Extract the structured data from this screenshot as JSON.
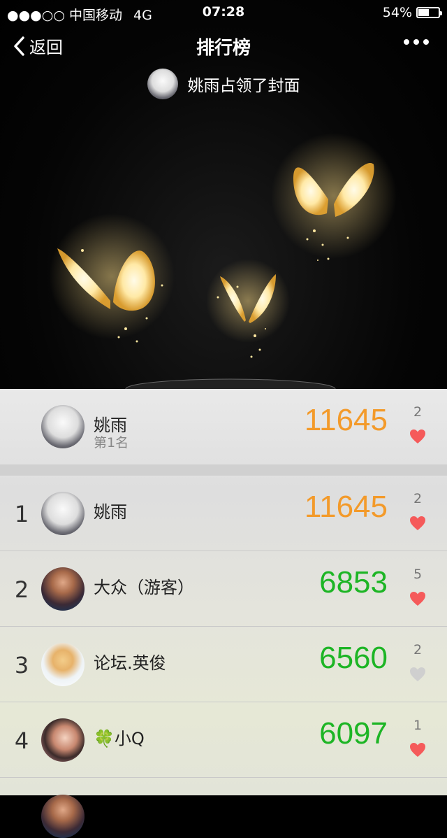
{
  "status_bar": {
    "signal": "●●●○○",
    "carrier": "中国移动",
    "network": "4G",
    "time": "07:28",
    "battery": "54%",
    "battery_level": 0.54
  },
  "nav": {
    "back_label": "返回",
    "title": "排行榜"
  },
  "cover": {
    "text": "姚雨占领了封面"
  },
  "my_rank": {
    "name": "姚雨",
    "position": "第1名",
    "steps": "11645",
    "likes": "2",
    "liked": true
  },
  "ranking": [
    {
      "rank": "1",
      "name": "姚雨",
      "steps": "11645",
      "likes": "2",
      "liked": true,
      "avatar": "girl-avatar"
    },
    {
      "rank": "2",
      "name": "大众（游客）",
      "steps": "6853",
      "likes": "5",
      "liked": true,
      "avatar": "man-avatar"
    },
    {
      "rank": "3",
      "name": "论坛.英俊",
      "steps": "6560",
      "likes": "2",
      "liked": false,
      "avatar": "monk-avatar"
    },
    {
      "rank": "4",
      "name": "🍀小Q",
      "steps": "6097",
      "likes": "1",
      "liked": true,
      "avatar": "mom-child-avatar"
    }
  ],
  "colors": {
    "top_steps": "#f39a2a",
    "steps": "#1db525",
    "heart_liked": "#f55a5a",
    "heart_unliked": "#cfcfcf"
  }
}
